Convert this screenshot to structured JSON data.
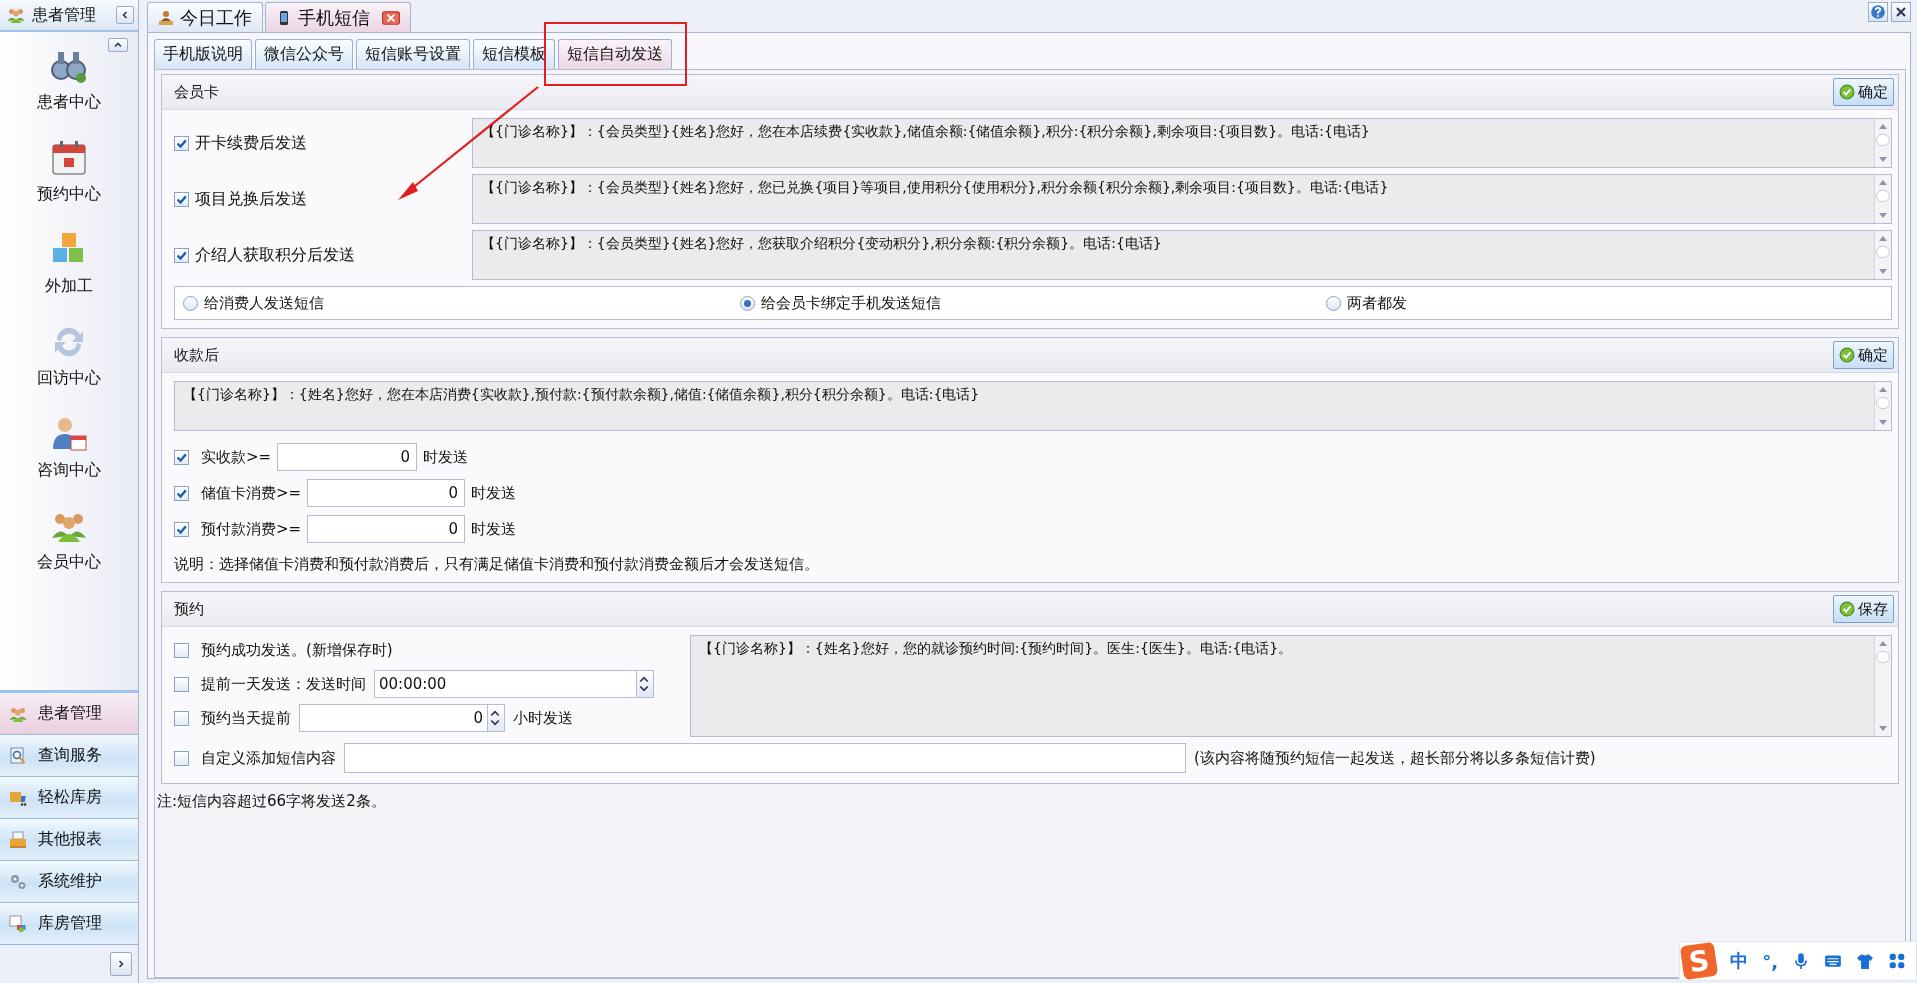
{
  "sidebar": {
    "title": "患者管理",
    "nav_items": [
      {
        "label": "患者中心"
      },
      {
        "label": "预约中心"
      },
      {
        "label": "外加工"
      },
      {
        "label": "回访中心"
      },
      {
        "label": "咨询中心"
      },
      {
        "label": "会员中心"
      }
    ],
    "modules": [
      {
        "label": "患者管理",
        "selected": true
      },
      {
        "label": "查询服务",
        "selected": false
      },
      {
        "label": "轻松库房",
        "selected": false
      },
      {
        "label": "其他报表",
        "selected": false
      },
      {
        "label": "系统维护",
        "selected": false
      },
      {
        "label": "库房管理",
        "selected": false
      }
    ]
  },
  "doc_tabs": [
    {
      "label": "今日工作",
      "selected": false,
      "closable": false
    },
    {
      "label": "手机短信",
      "selected": true,
      "closable": true
    }
  ],
  "tabs": [
    {
      "label": "手机版说明",
      "selected": false
    },
    {
      "label": "微信公众号",
      "selected": false
    },
    {
      "label": "短信账号设置",
      "selected": false
    },
    {
      "label": "短信模板",
      "selected": false
    },
    {
      "label": "短信自动发送",
      "selected": true
    }
  ],
  "member_card": {
    "title": "会员卡",
    "confirm_button": "确定",
    "rows": [
      {
        "label": "开卡续费后发送",
        "checked": true,
        "template": "【{门诊名称}】：{会员类型}{姓名}您好，您在本店续费{实收款},储值余额:{储值余额},积分:{积分余额},剩余项目:{项目数}。电话:{电话}"
      },
      {
        "label": "项目兑换后发送",
        "checked": true,
        "template": "【{门诊名称}】：{会员类型}{姓名}您好，您已兑换{项目}等项目,使用积分{使用积分},积分余额{积分余额},剩余项目:{项目数}。电话:{电话}"
      },
      {
        "label": "介绍人获取积分后发送",
        "checked": true,
        "template": "【{门诊名称}】：{会员类型}{姓名}您好，您获取介绍积分{变动积分},积分余额:{积分余额}。电话:{电话}"
      }
    ],
    "recipients": [
      {
        "label": "给消费人发送短信",
        "selected": false
      },
      {
        "label": "给会员卡绑定手机发送短信",
        "selected": true
      },
      {
        "label": "两者都发",
        "selected": false
      }
    ]
  },
  "payment": {
    "title": "收款后",
    "confirm_button": "确定",
    "template": "【{门诊名称}】：{姓名}您好，您在本店消费{实收款},预付款:{预付款余额},储值:{储值余额},积分{积分余额}。电话:{电话}",
    "thresholds": [
      {
        "label": "实收款>=",
        "value": "0",
        "suffix": "时发送",
        "checked": true
      },
      {
        "label": "储值卡消费>=",
        "value": "0",
        "suffix": "时发送",
        "checked": true
      },
      {
        "label": "预付款消费>=",
        "value": "0",
        "suffix": "时发送",
        "checked": true
      }
    ],
    "note": "说明：选择储值卡消费和预付款消费后，只有满足储值卡消费和预付款消费金额后才会发送短信。"
  },
  "appointment": {
    "title": "预约",
    "save_button": "保存",
    "template": "【{门诊名称}】：{姓名}您好，您的就诊预约时间:{预约时间}。医生:{医生}。电话:{电话}。",
    "options": [
      {
        "kind": "plain",
        "label": "预约成功发送。(新增保存时)",
        "checked": false
      },
      {
        "kind": "time",
        "label": "提前一天发送：发送时间",
        "value": "00:00:00",
        "checked": false
      },
      {
        "kind": "hours",
        "label": "预约当天提前",
        "value": "0",
        "suffix": "小时发送",
        "checked": false
      },
      {
        "kind": "text",
        "label": "自定义添加短信内容",
        "suffix": "(该内容将随预约短信一起发送，超长部分将以多条短信计费)",
        "checked": false
      }
    ]
  },
  "footer_note": "注:短信内容超过66字将发送2条。",
  "ime_bar": {
    "logo": "S",
    "items": [
      "中",
      "°,"
    ]
  }
}
